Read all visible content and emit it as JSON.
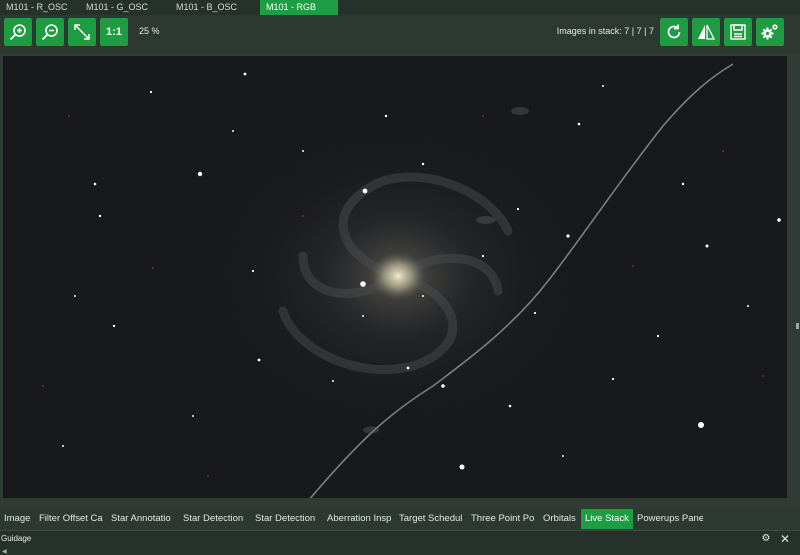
{
  "stack_tabs": [
    {
      "label": "M101 - R_OSC",
      "active": false
    },
    {
      "label": "M101 - G_OSC",
      "active": false
    },
    {
      "label": "M101 - B_OSC",
      "active": false
    },
    {
      "label": "M101 - RGB",
      "active": true
    }
  ],
  "toolbar": {
    "zoom_in_icon": "zoom-in",
    "zoom_out_icon": "zoom-out",
    "fit_icon": "fit-to-window",
    "one_to_one_label": "1:1",
    "zoom_level": "25 %",
    "stack_info": "Images in stack: 7 | 7 | 7",
    "refresh_icon": "refresh",
    "flip_icon": "flip",
    "save_icon": "save",
    "settings_icon": "settings-gears",
    "accent_color": "#1f9c42"
  },
  "bottom_tabs": [
    {
      "label": "Image",
      "active": false
    },
    {
      "label": "Filter Offset Ca",
      "active": false
    },
    {
      "label": "Star Annotatio",
      "active": false
    },
    {
      "label": "Star Detection",
      "active": false
    },
    {
      "label": "Star Detection",
      "active": false
    },
    {
      "label": "Aberration Insp",
      "active": false
    },
    {
      "label": "Target Schedul",
      "active": false
    },
    {
      "label": "Three Point Po",
      "active": false
    },
    {
      "label": "Orbitals",
      "active": false
    },
    {
      "label": "Live Stack",
      "active": true
    },
    {
      "label": "Powerups Pane",
      "active": false
    }
  ],
  "guidage_panel": {
    "title": "Guidage",
    "gear_icon": "settings-icon",
    "close_icon": "close-icon"
  }
}
